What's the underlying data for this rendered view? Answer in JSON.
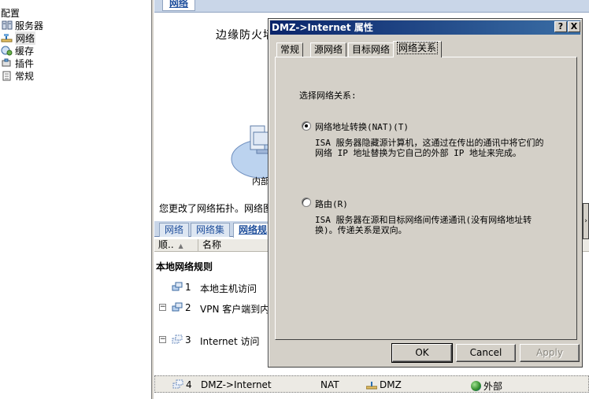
{
  "tree": {
    "root_label": "配置",
    "items": [
      {
        "label": "服务器",
        "icon": "server-icon"
      },
      {
        "label": "网络",
        "icon": "network-icon",
        "selected": true
      },
      {
        "label": "缓存",
        "icon": "cache-icon"
      },
      {
        "label": "插件",
        "icon": "addins-icon"
      },
      {
        "label": "常规",
        "icon": "general-icon"
      }
    ]
  },
  "main": {
    "top_tab": "网络",
    "edge_title": "边缘防火墙",
    "internal_label": "内部",
    "changed_message": "您更改了网络拓扑。网络图",
    "lower_tabs": [
      "网络",
      "网络集",
      "网络规"
    ],
    "grid_headers": {
      "order": "顺..",
      "name": "名称"
    },
    "section_title": "本地网络规则",
    "rows": [
      {
        "order": "1",
        "name": "本地主机访问",
        "expand": ""
      },
      {
        "order": "2",
        "name": "VPN 客户端到内部",
        "expand": "⊟"
      },
      {
        "order": "3",
        "name": "Internet 访问",
        "expand": "⊟"
      },
      {
        "order": "4",
        "name": "DMZ->Internet",
        "relation": "NAT",
        "source": "DMZ",
        "destination": "外部",
        "expand": ""
      }
    ]
  },
  "dialog": {
    "title": "DMZ->Internet 属性",
    "help_btn": "?",
    "close_btn": "X",
    "tabs": [
      "常规",
      "源网络",
      "目标网络",
      "网络关系"
    ],
    "active_tab": 3,
    "prompt": "选择网络关系:",
    "option_nat": {
      "label": "网络地址转换(NAT)(T)",
      "desc": "ISA 服务器隐藏源计算机，这通过在传出的通讯中将它们的网络 IP 地址替换为它自己的外部 IP 地址来完成。",
      "checked": true
    },
    "option_route": {
      "label": "路由(R)",
      "desc": "ISA 服务器在源和目标网络间传递通讯(没有网络地址转换)。传递关系是双向。",
      "checked": false
    },
    "buttons": {
      "ok": "OK",
      "cancel": "Cancel",
      "apply": "Apply"
    }
  },
  "colors": {
    "title_bar_start": "#0a246a",
    "title_bar_end": "#3a6ea5",
    "dialog_face": "#d4d0c8",
    "tab_blue": "#1f4f9c"
  }
}
